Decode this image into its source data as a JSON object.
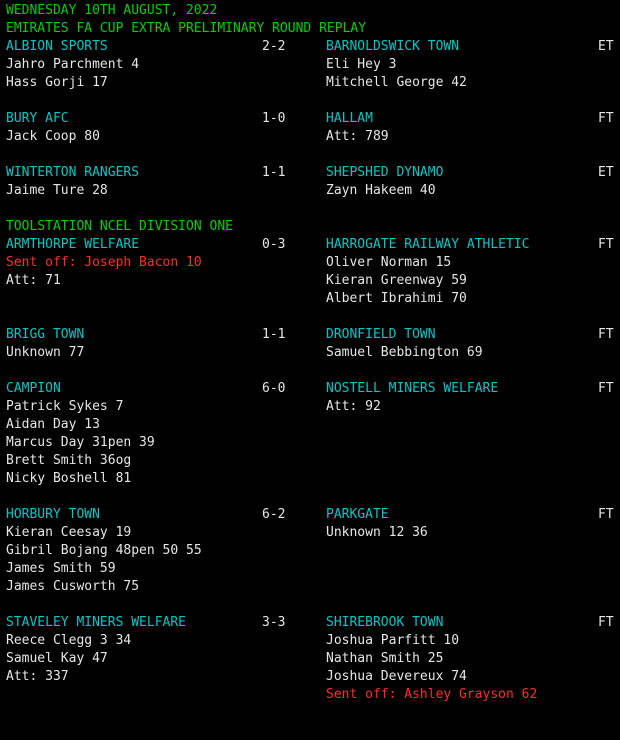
{
  "date": "WEDNESDAY 10TH AUGUST, 2022",
  "competitions": [
    "EMIRATES FA CUP EXTRA PRELIMINARY ROUND REPLAY",
    "TOOLSTATION NCEL DIVISION ONE"
  ],
  "matches": [
    {
      "home": "ALBION SPORTS",
      "score": "2-2",
      "away": "BARNOLDSWICK TOWN",
      "status": "ET",
      "home_lines": [
        "Jahro Parchment 4",
        "Hass Gorji 17"
      ],
      "away_lines": [
        "Eli Hey 3",
        "Mitchell George 42"
      ]
    },
    {
      "home": "BURY AFC",
      "score": "1-0",
      "away": "HALLAM",
      "status": "FT",
      "home_lines": [
        "Jack Coop 80"
      ],
      "away_lines": [
        "Att: 789"
      ]
    },
    {
      "home": "WINTERTON RANGERS",
      "score": "1-1",
      "away": "SHEPSHED DYNAMO",
      "status": "ET",
      "home_lines": [
        "Jaime Ture 28"
      ],
      "away_lines": [
        "Zayn Hakeem 40"
      ]
    },
    {
      "home": "ARMTHORPE WELFARE",
      "score": "0-3",
      "away": "HARROGATE RAILWAY ATHLETIC",
      "status": "FT",
      "home_lines": [
        "Sent off: Joseph Bacon 10",
        "Att: 71"
      ],
      "away_lines": [
        "Oliver Norman 15",
        "Kieran Greenway 59",
        "Albert Ibrahimi 70"
      ]
    },
    {
      "home": "BRIGG TOWN",
      "score": "1-1",
      "away": "DRONFIELD TOWN",
      "status": "FT",
      "home_lines": [
        "Unknown 77"
      ],
      "away_lines": [
        "Samuel Bebbington 69"
      ]
    },
    {
      "home": "CAMPION",
      "score": "6-0",
      "away": "NOSTELL MINERS WELFARE",
      "status": "FT",
      "home_lines": [
        "Patrick Sykes 7",
        "Aidan Day 13",
        "Marcus Day 31pen 39",
        "Brett Smith 36og",
        "Nicky Boshell 81"
      ],
      "away_lines": [
        "Att: 92"
      ]
    },
    {
      "home": "HORBURY TOWN",
      "score": "6-2",
      "away": "PARKGATE",
      "status": "FT",
      "home_lines": [
        "Kieran Ceesay 19",
        "Gibril Bojang 48pen 50 55",
        "James Smith 59",
        "James Cusworth 75"
      ],
      "away_lines": [
        "Unknown 12 36"
      ]
    },
    {
      "home": "STAVELEY MINERS WELFARE",
      "score": "3-3",
      "away": "SHIREBROOK TOWN",
      "status": "FT",
      "home_lines": [
        "Reece Clegg 3 34",
        "Samuel Kay 47",
        "Att: 337"
      ],
      "away_lines": [
        "Joshua Parfitt 10",
        "Nathan Smith 25",
        "Joshua Devereux 74",
        "Sent off: Ashley Grayson 62"
      ]
    }
  ],
  "colors": {
    "background": "#000000",
    "header": "#00d200",
    "team": "#00c8c8",
    "text": "#e6e6e6",
    "sent_off": "#ff2b2b"
  }
}
